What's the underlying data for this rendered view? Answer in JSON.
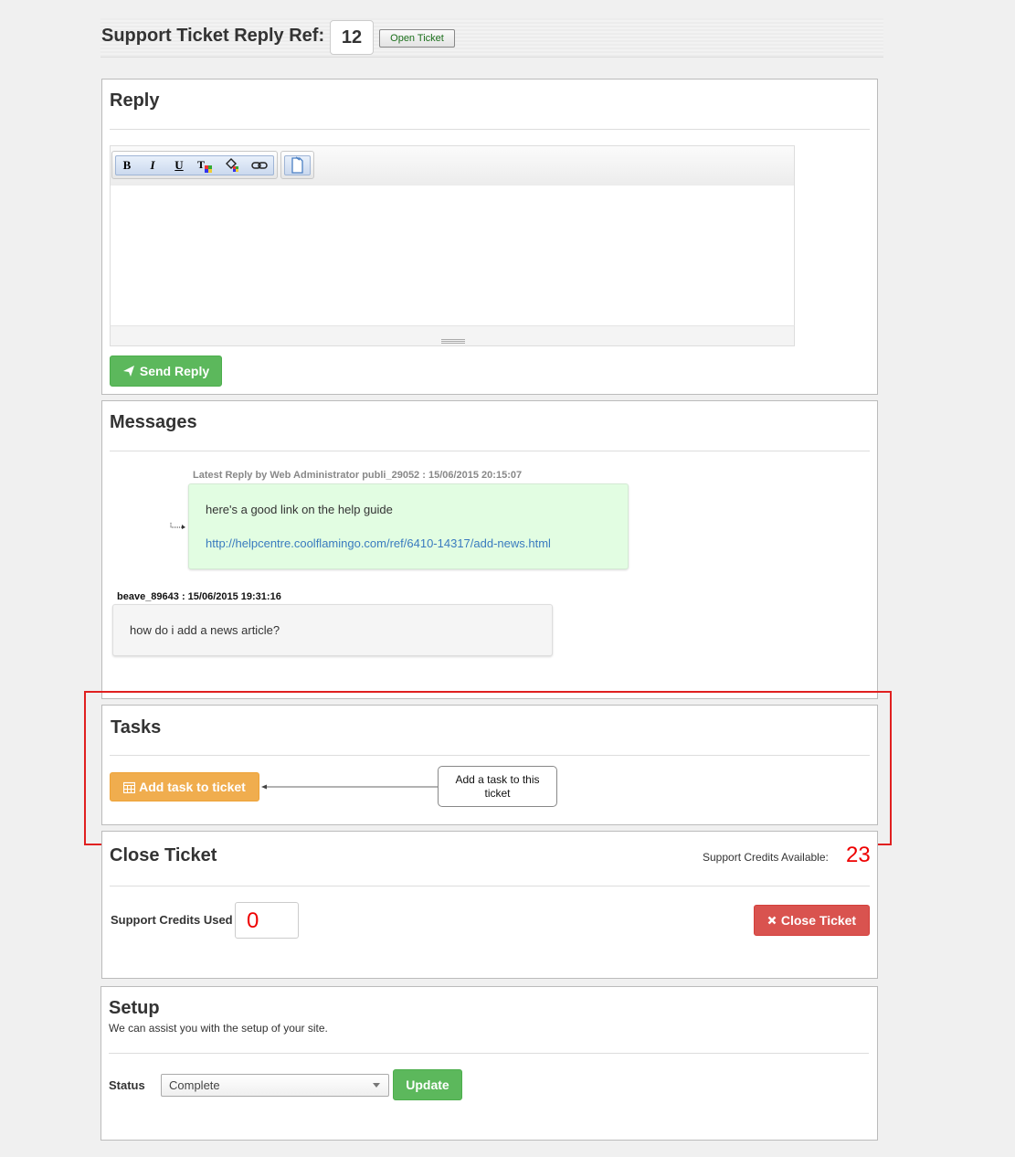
{
  "header": {
    "title": "Support Ticket Reply Ref:",
    "ref_number": "12",
    "status_button": "Open Ticket"
  },
  "reply": {
    "title": "Reply",
    "toolbar": {
      "bold": "B",
      "italic": "I",
      "underline": "U"
    },
    "send_button": "Send Reply"
  },
  "messages": {
    "title": "Messages",
    "items": [
      {
        "meta": "Latest Reply by Web Administrator  publi_29052 : 15/06/2015 20:15:07",
        "text": "here's a good link on the help guide",
        "link": "http://helpcentre.coolflamingo.com/ref/6410-14317/add-news.html",
        "color": "#e2fde2"
      },
      {
        "meta": "beave_89643 : 15/06/2015 19:31:16",
        "text": "how do i add a news article?",
        "color": "#f5f5f5"
      }
    ]
  },
  "tasks": {
    "title": "Tasks",
    "add_button": "Add task to ticket",
    "callout": "Add a task to this ticket"
  },
  "close_ticket": {
    "title": "Close Ticket",
    "credits_available_label": "Support Credits Available:",
    "credits_available_value": "23",
    "credits_used_label": "Support Credits Used",
    "credits_used_value": "0",
    "close_button": "Close Ticket"
  },
  "setup": {
    "title": "Setup",
    "description": "We can assist you with the setup of your site.",
    "status_label": "Status",
    "status_value": "Complete",
    "update_button": "Update"
  },
  "colors": {
    "green": "#5cb85c",
    "orange": "#f0ad4e",
    "red": "#d9534f",
    "highlight": "#e02020"
  }
}
